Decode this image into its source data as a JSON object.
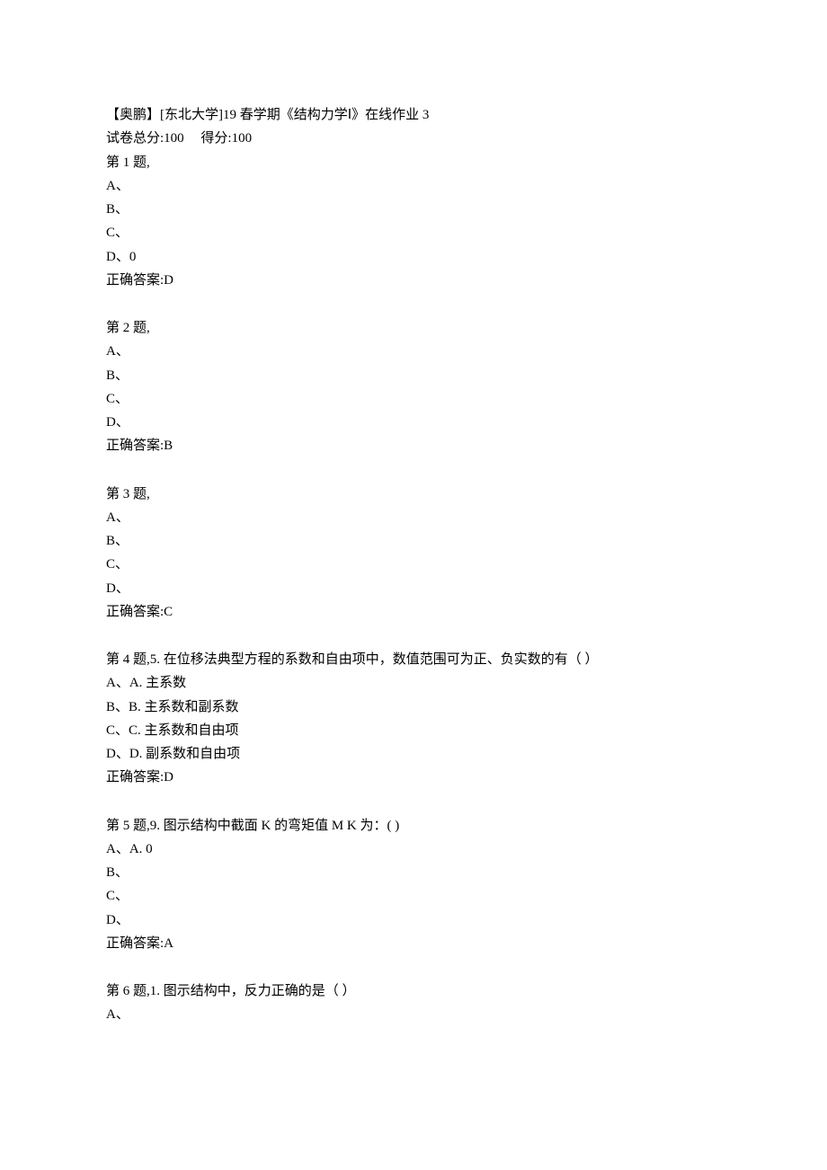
{
  "header": {
    "title_line": "【奥鹏】[东北大学]19 春学期《结构力学Ⅰ》在线作业 3",
    "score_line": "试卷总分:100     得分:100"
  },
  "questions": [
    {
      "heading": "第 1 题,",
      "options": [
        "A、",
        "B、",
        "C、",
        "D、0"
      ],
      "answer": "正确答案:D"
    },
    {
      "heading": "第 2 题,",
      "options": [
        "A、",
        "B、",
        "C、",
        "D、"
      ],
      "answer": "正确答案:B"
    },
    {
      "heading": "第 3 题,",
      "options": [
        "A、",
        "B、",
        "C、",
        "D、"
      ],
      "answer": "正确答案:C"
    },
    {
      "heading": "第 4 题,5. 在位移法典型方程的系数和自由项中，数值范围可为正、负实数的有（ ）",
      "options": [
        "A、A. 主系数",
        "B、B. 主系数和副系数",
        "C、C. 主系数和自由项",
        "D、D. 副系数和自由项"
      ],
      "answer": "正确答案:D"
    },
    {
      "heading": "第 5 题,9. 图示结构中截面 K 的弯矩值 M K 为：( )",
      "options": [
        "A、A. 0",
        "B、",
        "C、",
        "D、"
      ],
      "answer": "正确答案:A"
    },
    {
      "heading": "第 6 题,1. 图示结构中，反力正确的是（ ）",
      "options": [
        "A、"
      ],
      "answer": null
    }
  ]
}
